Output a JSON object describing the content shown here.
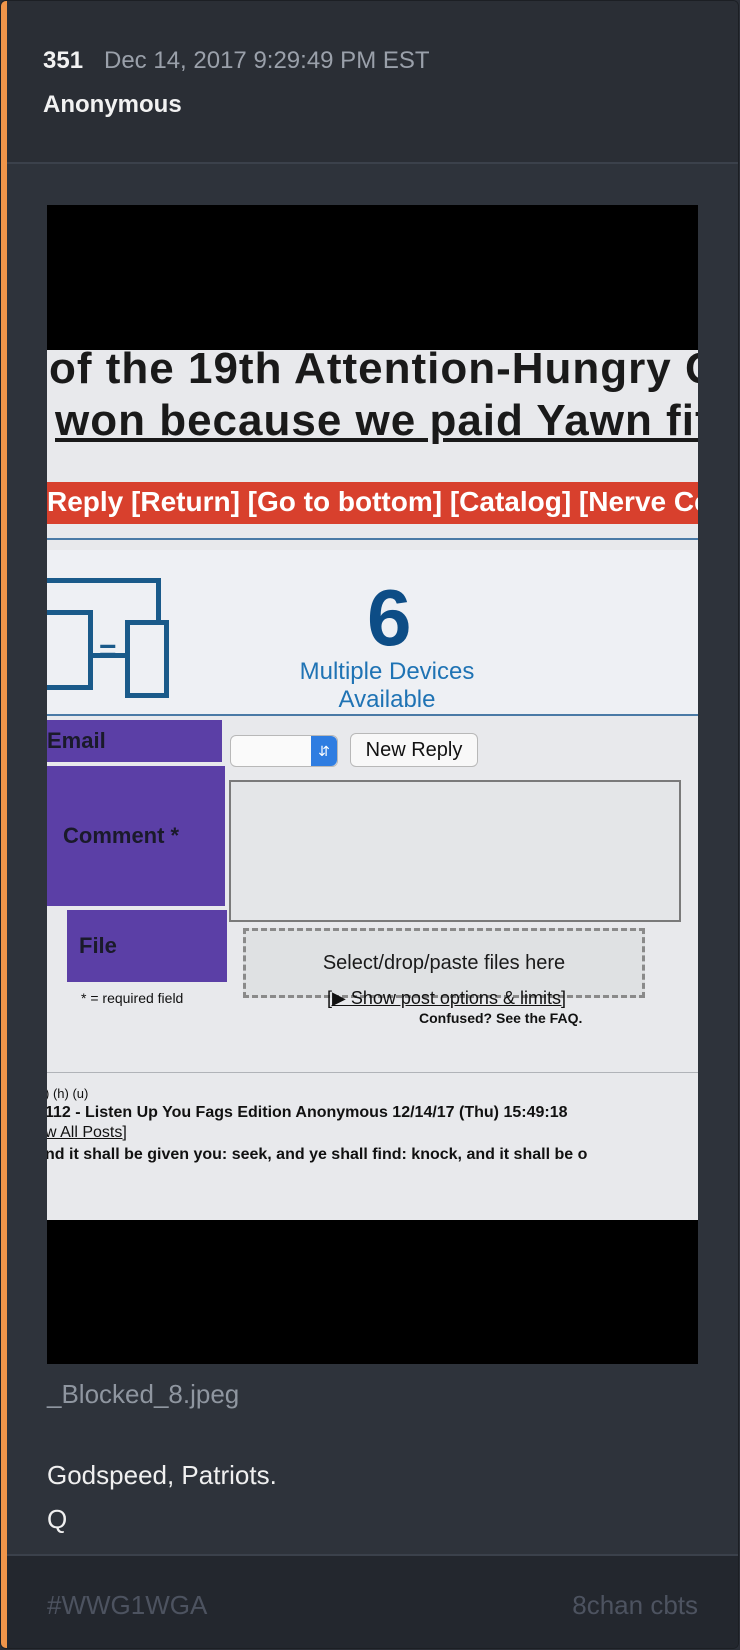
{
  "post": {
    "number": "351",
    "date": "Dec 14, 2017 9:29:49 PM EST",
    "author": "Anonymous",
    "filename": "_Blocked_8.jpeg",
    "body_lines": [
      "Godspeed, Patriots.",
      "Q"
    ]
  },
  "photo": {
    "headline_1": "of the 19th Attention-Hungry G",
    "headline_2": "won because we paid Yawn fif",
    "nav": "Reply [Return] [Go to bottom] [Catalog] [Nerve Ce",
    "ad_number": "6",
    "ad_text_1": "Multiple Devices",
    "ad_text_2": "Available",
    "label_email": "Email",
    "label_comment": "Comment *",
    "label_file": "File",
    "button_new_reply": "New Reply",
    "dropzone": "Select/drop/paste files here",
    "required_note": "* = required field",
    "show_options": "[▶ Show post options & limits]",
    "faq": "Confused? See the FAQ.",
    "post_links": ") (h) (u)",
    "post_line": "112 - Listen Up You Fags Edition Anonymous  12/14/17 (Thu) 15:49:18",
    "view_all": "w All Posts]",
    "cut_line": "nd it shall be given you: seek, and ye shall find: knock, and it shall be o"
  },
  "footer": {
    "tag": "#WWG1WGA",
    "source": "8chan cbts"
  },
  "colors": {
    "accent": "#f0954a",
    "card": "#2e333b",
    "header": "#2a2e35",
    "footer": "#23272e"
  }
}
